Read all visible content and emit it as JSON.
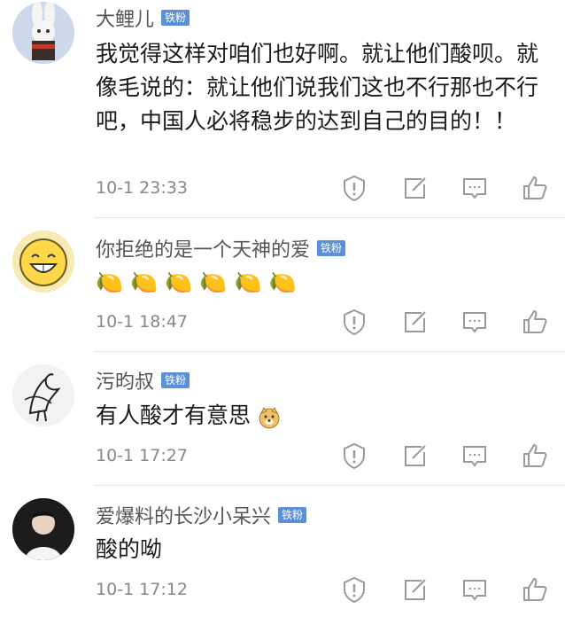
{
  "comments": [
    {
      "name": "大鲤儿",
      "badge": "铁粉",
      "text": "我觉得这样对咱们也好啊。就让他们酸呗。就像毛说的：就让他们说我们这也不行那也不行吧，中国人必将稳步的达到自己的目的！！",
      "time": "10-1 23:33",
      "avatar_icon": "rabbit-character-avatar"
    },
    {
      "name": "你拒绝的是一个天神的爱",
      "badge": "铁粉",
      "text": "🍋🍋🍋🍋🍋🍋",
      "time": "10-1 18:47",
      "avatar_icon": "laughing-face-avatar"
    },
    {
      "name": "污昀叔",
      "badge": "铁粉",
      "text": "有人酸才有意思",
      "time": "10-1 17:27",
      "avatar_icon": "crane-avatar"
    },
    {
      "name": "爱爆料的长沙小呆兴",
      "badge": "铁粉",
      "text": "酸的呦",
      "time": "10-1 17:12",
      "avatar_icon": "person-photo-avatar"
    }
  ],
  "icons": {
    "report": "report-icon",
    "share": "share-edit-icon",
    "reply": "comment-icon",
    "like": "thumbs-up-icon"
  },
  "colors": {
    "badge": "#5b8fd8",
    "icon": "#9a9a9a"
  }
}
